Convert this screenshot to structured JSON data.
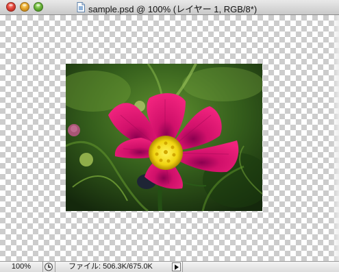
{
  "window": {
    "title": "sample.psd @ 100% (レイヤー 1, RGB/8*)",
    "traffic_lights": [
      "close",
      "minimize",
      "zoom"
    ],
    "document_icon": "psd-document-icon"
  },
  "canvas": {
    "background": "transparency-checkerboard",
    "image": {
      "subject": "pink cosmos flower with yellow center on green background",
      "colors": {
        "petal": "#e0106b",
        "center": "#f2e21a",
        "background": "#2f5a18"
      }
    }
  },
  "statusbar": {
    "zoom": "100%",
    "doc_info": "ファイル: 506.3K/675.0K",
    "menu_arrow_icon": "triangle-right-icon"
  }
}
